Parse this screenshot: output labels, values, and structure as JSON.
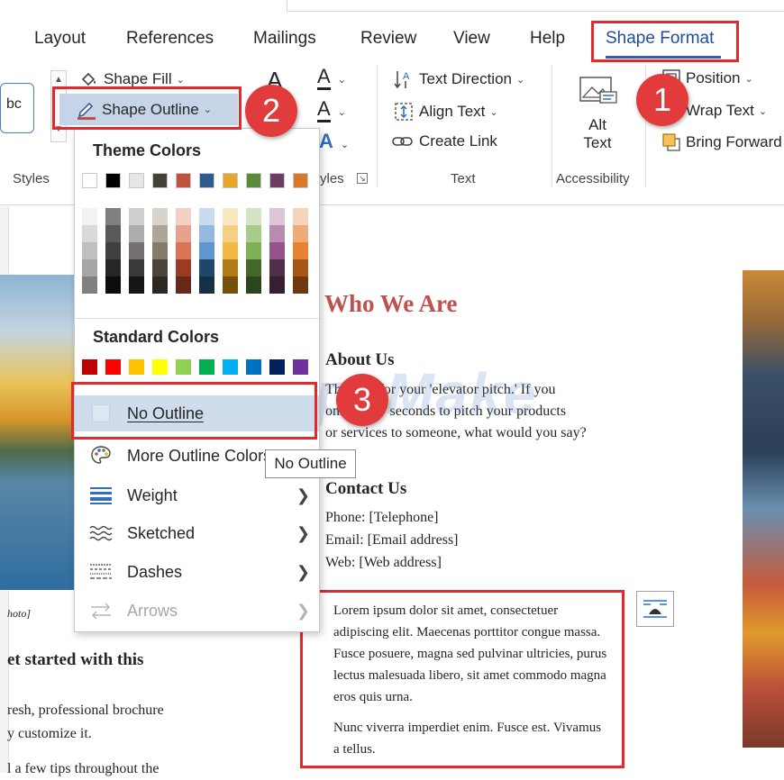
{
  "tabs": [
    {
      "label": "Layout"
    },
    {
      "label": "References"
    },
    {
      "label": "Mailings"
    },
    {
      "label": "Review"
    },
    {
      "label": "View"
    },
    {
      "label": "Help"
    },
    {
      "label": "Shape Format",
      "active": true
    }
  ],
  "ribbon": {
    "shape_fill": "Shape Fill",
    "shape_outline": "Shape Outline",
    "style_preview": "bc",
    "styles_group": "Styles",
    "text_styles_group": "yles",
    "text_direction": "Text Direction",
    "align_text": "Align Text",
    "create_link": "Create Link",
    "text_group": "Text",
    "alt_text_line1": "Alt",
    "alt_text_line2": "Text",
    "accessibility_group": "Accessibility",
    "position": "Position",
    "wrap_text": "Wrap Text",
    "bring_forward": "Bring Forward"
  },
  "menu": {
    "theme_colors_label": "Theme Colors",
    "standard_colors_label": "Standard Colors",
    "theme_top_row": [
      "#ffffff",
      "#000000",
      "#e7e6e6",
      "#44413a",
      "#c0533d",
      "#2b5c8a",
      "#e4a72a",
      "#5b8a3a",
      "#6c3e63",
      "#d9772b"
    ],
    "theme_shade_columns": [
      [
        "#f2f2f2",
        "#d9d9d9",
        "#bfbfbf",
        "#a6a6a6",
        "#7f7f7f"
      ],
      [
        "#7f7f7f",
        "#595959",
        "#404040",
        "#262626",
        "#0d0d0d"
      ],
      [
        "#d0cece",
        "#aeabab",
        "#757171",
        "#3b3838",
        "#171616"
      ],
      [
        "#d6d3cc",
        "#ada698",
        "#847b68",
        "#4a453b",
        "#2b2823"
      ],
      [
        "#f2d0c6",
        "#e6a28e",
        "#d97456",
        "#9a3b25",
        "#672719"
      ],
      [
        "#c9dcef",
        "#94b9df",
        "#5e96cf",
        "#204669",
        "#152f46"
      ],
      [
        "#fbe7c0",
        "#f6cf82",
        "#f2b745",
        "#b07b12",
        "#75520c"
      ],
      [
        "#d4e5c6",
        "#a9cb8d",
        "#7eb155",
        "#44672a",
        "#2d451c"
      ],
      [
        "#dcc5d7",
        "#b98bae",
        "#96528a",
        "#502e49",
        "#361f31"
      ],
      [
        "#f7d5bb",
        "#f0ac78",
        "#e88334",
        "#a65517",
        "#6f380f"
      ]
    ],
    "standard_colors": [
      "#c00000",
      "#ff0000",
      "#ffc000",
      "#ffff00",
      "#92d050",
      "#00b050",
      "#00b0f0",
      "#0070c0",
      "#002060",
      "#7030a0"
    ],
    "no_outline": "No Outline",
    "more_outline_colors": "More Outline Colors...",
    "weight": "Weight",
    "sketched": "Sketched",
    "dashes": "Dashes",
    "arrows": "Arrows"
  },
  "tooltip": "No Outline",
  "badges": [
    "1",
    "2",
    "3"
  ],
  "watermark": "TipsMake",
  "document": {
    "heading": "Who We Are",
    "about_heading": "About Us",
    "about_text": [
      "Th     place for your 'elevator pitch.' If you",
      "only      a few seconds to pitch your products",
      "or services to someone, what would you say?"
    ],
    "contact_heading": "Contact Us",
    "phone": "Phone: [Telephone]",
    "email": "Email: [Email address]",
    "web": "Web: [Web address]",
    "textbox_p1": "Lorem ipsum dolor sit amet, consectetuer adipiscing elit. Maecenas porttitor congue massa. Fusce posuere, magna sed pulvinar ultricies, purus lectus malesuada libero, sit amet commodo magna eros quis urna.",
    "textbox_p2": "Nunc viverra imperdiet enim. Fusce est. Vivamus a tellus.",
    "caption_fragment": "hoto]",
    "left_heading_fragment": "et started with this",
    "left_text_1": "resh, professional brochure",
    "left_text_2": "y customize it.",
    "left_text_3": "l a few tips throughout the"
  }
}
